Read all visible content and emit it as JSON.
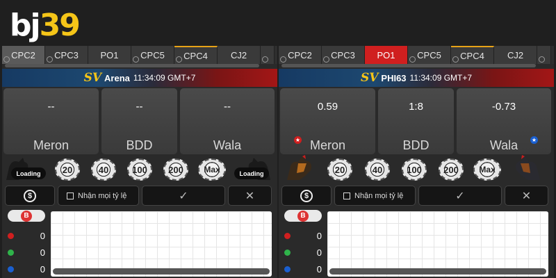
{
  "logo": {
    "bj": "bj",
    "num": "39"
  },
  "panels": [
    {
      "tabs": [
        "CPC2",
        "CPC3",
        "PO1",
        "CPC5",
        "CPC4",
        "CJ2"
      ],
      "banner": {
        "logo": "SV",
        "name": "Arena",
        "time": "11:34:09 GMT+7"
      },
      "bets": [
        {
          "odds": "--",
          "label": "Meron"
        },
        {
          "odds": "--",
          "label": "BDD"
        },
        {
          "odds": "--",
          "label": "Wala"
        }
      ],
      "chips": [
        "20",
        "40",
        "100",
        "200",
        "Max"
      ],
      "loading_left": "Loading",
      "loading_right": "Loading",
      "accept_label": "Nhận mọi tỷ lệ",
      "settings_icon": "$",
      "confirm_icon": "✓",
      "cancel_icon": "✕",
      "stats": {
        "b": "B",
        "red": "0",
        "green": "0",
        "blue": "0"
      }
    },
    {
      "tabs": [
        "CPC2",
        "CPC3",
        "PO1",
        "CPC5",
        "CPC4",
        "CJ2"
      ],
      "banner": {
        "logo": "SV",
        "name": "PHI63",
        "time": "11:34:09 GMT+7"
      },
      "bets": [
        {
          "odds": "0.59",
          "label": "Meron"
        },
        {
          "odds": "1:8",
          "label": "BDD"
        },
        {
          "odds": "-0.73",
          "label": "Wala"
        }
      ],
      "chips": [
        "20",
        "40",
        "100",
        "200",
        "Max"
      ],
      "accept_label": "Nhận mọi tỷ lệ",
      "settings_icon": "$",
      "confirm_icon": "✓",
      "cancel_icon": "✕",
      "badge_red": "★",
      "badge_blue": "★",
      "stats": {
        "b": "B",
        "red": "0",
        "green": "0",
        "blue": "0"
      }
    }
  ],
  "colors": {
    "accent_red": "#d01f1f",
    "accent_gold": "#f5c518",
    "wala_blue": "#1a5fd0",
    "draw_green": "#2fb34a"
  }
}
